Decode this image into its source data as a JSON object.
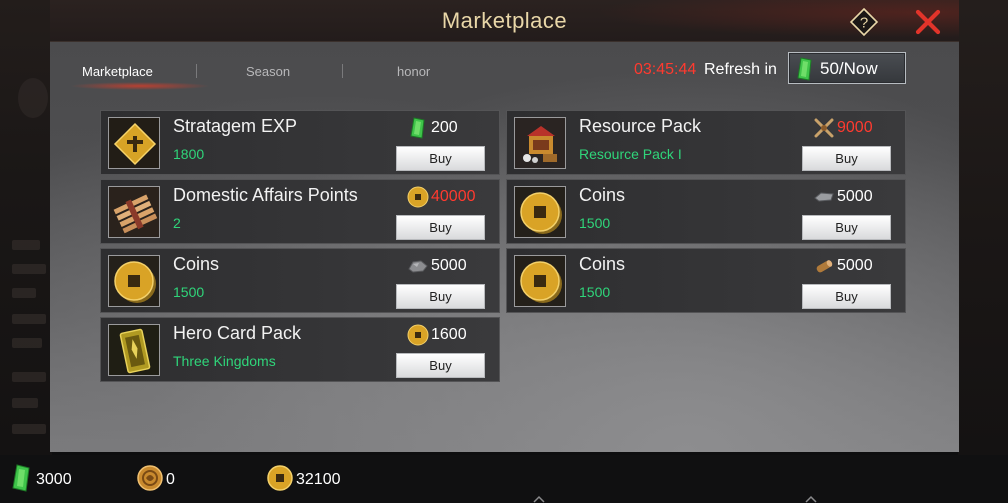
{
  "title": "Marketplace",
  "tabs": [
    {
      "label": "Marketplace",
      "active": true
    },
    {
      "label": "Season",
      "active": false
    },
    {
      "label": "honor",
      "active": false
    }
  ],
  "refresh": {
    "timer": "03:45:44",
    "label": "Refresh in",
    "button": "50/Now"
  },
  "items": [
    {
      "name": "Stratagem EXP",
      "sub": "1800",
      "price": "200",
      "price_icon": "jade-icon",
      "price_color": "white",
      "thumb": "stratagem-exp-icon",
      "buy": "Buy"
    },
    {
      "name": "Resource Pack",
      "sub": "Resource Pack I",
      "price": "9000",
      "price_icon": "crossed-weapons-icon",
      "price_color": "red",
      "thumb": "resource-pack-icon",
      "buy": "Buy"
    },
    {
      "name": "Domestic Affairs Points",
      "sub": "2",
      "price": "40000",
      "price_icon": "coin-icon",
      "price_color": "red",
      "thumb": "scroll-bundle-icon",
      "buy": "Buy"
    },
    {
      "name": "Coins",
      "sub": "1500",
      "price": "5000",
      "price_icon": "iron-icon",
      "price_color": "white",
      "thumb": "coin-icon",
      "buy": "Buy"
    },
    {
      "name": "Coins",
      "sub": "1500",
      "price": "5000",
      "price_icon": "stone-icon",
      "price_color": "white",
      "thumb": "coin-icon",
      "buy": "Buy"
    },
    {
      "name": "Coins",
      "sub": "1500",
      "price": "5000",
      "price_icon": "wood-icon",
      "price_color": "white",
      "thumb": "coin-icon",
      "buy": "Buy"
    },
    {
      "name": "Hero Card Pack",
      "sub": "Three Kingdoms",
      "price": "1600",
      "price_icon": "coin-icon",
      "price_color": "white",
      "thumb": "hero-card-icon",
      "buy": "Buy"
    }
  ],
  "currencies": [
    {
      "icon": "jade-icon",
      "value": "3000"
    },
    {
      "icon": "honor-medal-icon",
      "value": "0"
    },
    {
      "icon": "coin-icon",
      "value": "32100"
    }
  ],
  "colors": {
    "accent_green": "#2fd57a",
    "accent_red": "#ff3a2f",
    "title_gold": "#e9d7a8"
  }
}
